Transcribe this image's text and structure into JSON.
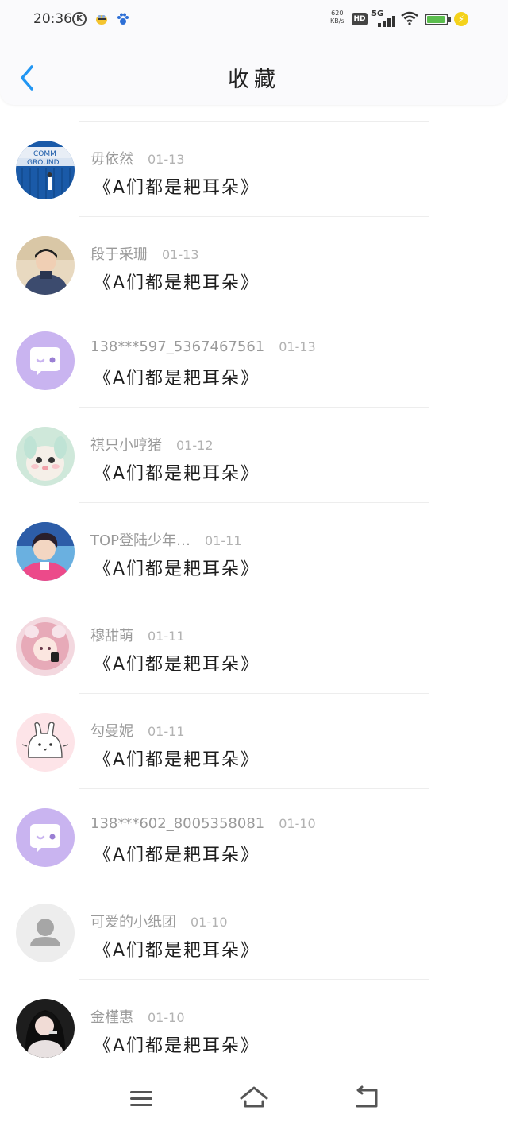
{
  "status_bar": {
    "time": "20:36",
    "net_speed_top": "620",
    "net_speed_bottom": "KB/s",
    "hd_label": "HD",
    "network_label": "5G",
    "k_label": "K",
    "battery_level": 0.95,
    "icons": [
      "k-circle-icon",
      "bee-app-icon",
      "paw-app-icon",
      "hd-icon",
      "signal-icon",
      "wifi-icon",
      "battery-icon",
      "charging-icon"
    ]
  },
  "header": {
    "title": "收藏",
    "back_icon": "chevron-left-icon"
  },
  "colors": {
    "accent": "#2196f3",
    "name_text": "#9a9a9a",
    "date_text": "#b2b2b2",
    "content_text": "#1e1e1e",
    "divider": "#ededed",
    "purple_avatar": "#c9b4f0",
    "pink_avatar": "#fde4e8"
  },
  "items": [
    {
      "name": "毋依然",
      "date": "01-13",
      "content": "《A们都是耙耳朵》",
      "avatar": "photo-blue-container"
    },
    {
      "name": "段于采珊",
      "date": "01-13",
      "content": "《A们都是耙耳朵》",
      "avatar": "photo-boy"
    },
    {
      "name": "138***597_5367467561",
      "date": "01-13",
      "content": "《A们都是耙耳朵》",
      "avatar": "purple-chat-icon"
    },
    {
      "name": "祺只小哼猪",
      "date": "01-12",
      "content": "《A们都是耙耳朵》",
      "avatar": "photo-cat"
    },
    {
      "name": "TOP登陆少年…",
      "date": "01-11",
      "content": "《A们都是耙耳朵》",
      "avatar": "photo-boy-pink"
    },
    {
      "name": "穆甜萌",
      "date": "01-11",
      "content": "《A们都是耙耳朵》",
      "avatar": "photo-pink-girl"
    },
    {
      "name": "勾曼妮",
      "date": "01-11",
      "content": "《A们都是耙耳朵》",
      "avatar": "pink-rabbit-icon"
    },
    {
      "name": "138***602_8005358081",
      "date": "01-10",
      "content": "《A们都是耙耳朵》",
      "avatar": "purple-chat-icon"
    },
    {
      "name": "可爱的小纸团",
      "date": "01-10",
      "content": "《A们都是耙耳朵》",
      "avatar": "grey-person-icon"
    },
    {
      "name": "金槿惠",
      "date": "01-10",
      "content": "《A们都是耙耳朵》",
      "avatar": "photo-dark-girl"
    }
  ],
  "navbar": {
    "menu_icon": "menu-icon",
    "home_icon": "home-icon",
    "back_icon": "back-icon"
  }
}
